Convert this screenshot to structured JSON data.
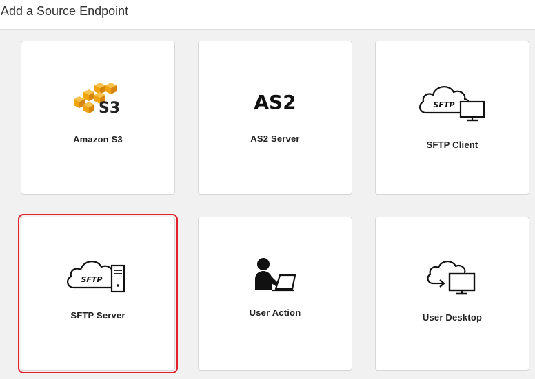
{
  "header": {
    "title": "Add a Source Endpoint"
  },
  "accent_color": "#e0202a",
  "endpoints": [
    {
      "label": "Amazon S3",
      "icon": "amazon-s3-icon",
      "logo_text": "S3",
      "selected": false
    },
    {
      "label": "AS2 Server",
      "icon": "as2-icon",
      "logo_text": "AS2",
      "selected": false
    },
    {
      "label": "SFTP Client",
      "icon": "sftp-client-icon",
      "logo_text": "SFTP",
      "selected": false
    },
    {
      "label": "SFTP Server",
      "icon": "sftp-server-icon",
      "logo_text": "SFTP",
      "selected": true
    },
    {
      "label": "User Action",
      "icon": "user-action-icon",
      "selected": false
    },
    {
      "label": "User Desktop",
      "icon": "user-desktop-icon",
      "selected": false
    }
  ]
}
